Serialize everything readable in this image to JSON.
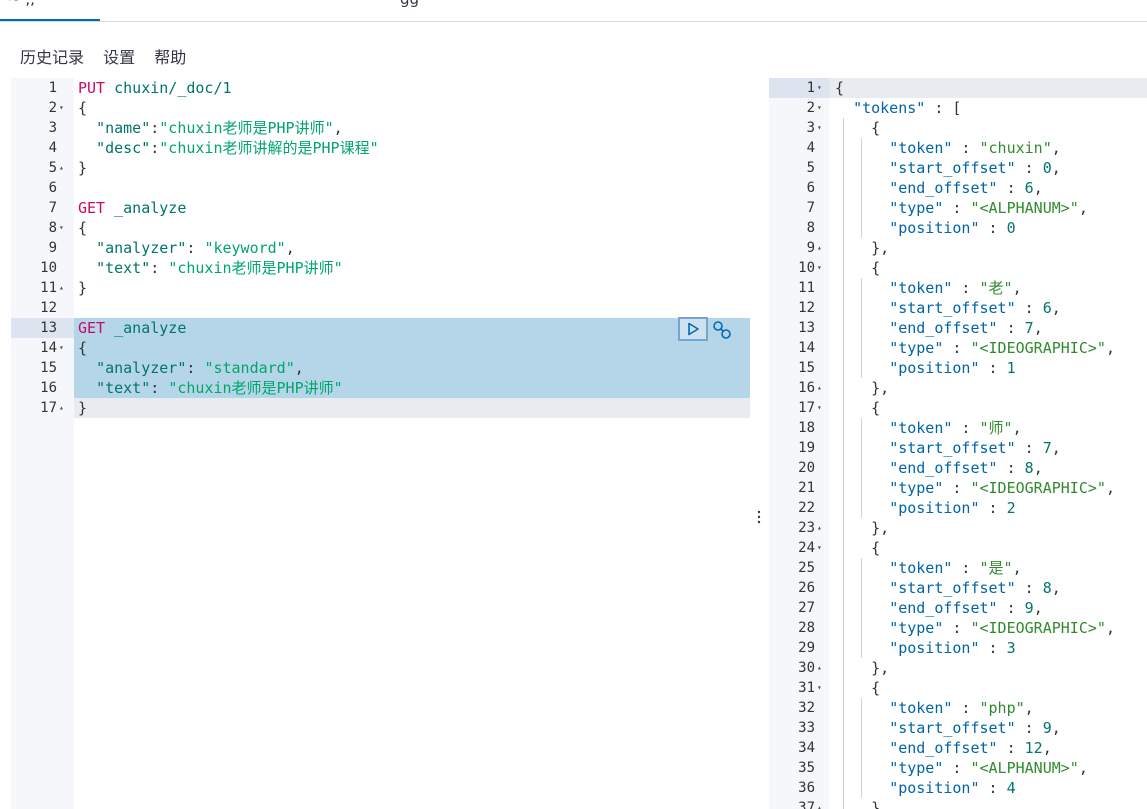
{
  "tabs": {
    "fragment_left": "~ ,,",
    "fragment_right": "gg"
  },
  "menu": {
    "history": "历史记录",
    "settings": "设置",
    "help": "帮助"
  },
  "request_lines": [
    {
      "n": "1",
      "fold": "",
      "parts": [
        [
          "kw",
          "PUT"
        ],
        [
          "pl",
          " "
        ],
        [
          "url",
          "chuxin/_doc/1"
        ]
      ]
    },
    {
      "n": "2",
      "fold": "▾",
      "parts": [
        [
          "pl",
          "{"
        ]
      ]
    },
    {
      "n": "3",
      "fold": "",
      "parts": [
        [
          "pl",
          "  "
        ],
        [
          "key",
          "\"name\""
        ],
        [
          "pl",
          ":"
        ],
        [
          "str",
          "\"chuxin老师是PHP讲师\""
        ],
        [
          "pl",
          ","
        ]
      ]
    },
    {
      "n": "4",
      "fold": "",
      "parts": [
        [
          "pl",
          "  "
        ],
        [
          "key",
          "\"desc\""
        ],
        [
          "pl",
          ":"
        ],
        [
          "str",
          "\"chuxin老师讲解的是PHP课程\""
        ]
      ]
    },
    {
      "n": "5",
      "fold": "▴",
      "parts": [
        [
          "pl",
          "}"
        ]
      ]
    },
    {
      "n": "6",
      "fold": "",
      "parts": []
    },
    {
      "n": "7",
      "fold": "",
      "parts": [
        [
          "kw",
          "GET"
        ],
        [
          "pl",
          " "
        ],
        [
          "url",
          "_analyze"
        ]
      ]
    },
    {
      "n": "8",
      "fold": "▾",
      "parts": [
        [
          "pl",
          "{"
        ]
      ]
    },
    {
      "n": "9",
      "fold": "",
      "parts": [
        [
          "pl",
          "  "
        ],
        [
          "key",
          "\"analyzer\""
        ],
        [
          "pl",
          ": "
        ],
        [
          "str",
          "\"keyword\""
        ],
        [
          "pl",
          ","
        ]
      ]
    },
    {
      "n": "10",
      "fold": "",
      "parts": [
        [
          "pl",
          "  "
        ],
        [
          "key",
          "\"text\""
        ],
        [
          "pl",
          ": "
        ],
        [
          "str",
          "\"chuxin老师是PHP讲师\""
        ]
      ]
    },
    {
      "n": "11",
      "fold": "▴",
      "parts": [
        [
          "pl",
          "}"
        ]
      ]
    },
    {
      "n": "12",
      "fold": "",
      "parts": []
    },
    {
      "n": "13",
      "fold": "",
      "sel": true,
      "parts": [
        [
          "kw",
          "GET"
        ],
        [
          "pl",
          " "
        ],
        [
          "url",
          "_analyze"
        ]
      ]
    },
    {
      "n": "14",
      "fold": "▾",
      "sel": true,
      "parts": [
        [
          "pl",
          "{"
        ]
      ]
    },
    {
      "n": "15",
      "fold": "",
      "sel": true,
      "parts": [
        [
          "pl",
          "  "
        ],
        [
          "key",
          "\"analyzer\""
        ],
        [
          "pl",
          ": "
        ],
        [
          "str",
          "\"standard\""
        ],
        [
          "pl",
          ","
        ]
      ]
    },
    {
      "n": "16",
      "fold": "",
      "sel": true,
      "parts": [
        [
          "pl",
          "  "
        ],
        [
          "key",
          "\"text\""
        ],
        [
          "pl",
          ": "
        ],
        [
          "str",
          "\"chuxin老师是PHP讲师\""
        ]
      ]
    },
    {
      "n": "17",
      "fold": "▴",
      "cur": true,
      "parts": [
        [
          "pl",
          "}"
        ]
      ]
    }
  ],
  "response_lines": [
    {
      "n": "1",
      "fold": "▾",
      "first": true,
      "parts": [
        [
          "pl",
          "{"
        ]
      ]
    },
    {
      "n": "2",
      "fold": "▾",
      "parts": [
        [
          "pl",
          "  "
        ],
        [
          "key2",
          "\"tokens\""
        ],
        [
          "pl",
          " : ["
        ]
      ]
    },
    {
      "n": "3",
      "fold": "▾",
      "parts": [
        [
          "pl",
          "    {"
        ]
      ]
    },
    {
      "n": "4",
      "fold": "",
      "parts": [
        [
          "pl",
          "      "
        ],
        [
          "key2",
          "\"token\""
        ],
        [
          "pl",
          " : "
        ],
        [
          "str2",
          "\"chuxin\""
        ],
        [
          "pl",
          ","
        ]
      ]
    },
    {
      "n": "5",
      "fold": "",
      "parts": [
        [
          "pl",
          "      "
        ],
        [
          "key2",
          "\"start_offset\""
        ],
        [
          "pl",
          " : "
        ],
        [
          "num",
          "0"
        ],
        [
          "pl",
          ","
        ]
      ]
    },
    {
      "n": "6",
      "fold": "",
      "parts": [
        [
          "pl",
          "      "
        ],
        [
          "key2",
          "\"end_offset\""
        ],
        [
          "pl",
          " : "
        ],
        [
          "num",
          "6"
        ],
        [
          "pl",
          ","
        ]
      ]
    },
    {
      "n": "7",
      "fold": "",
      "parts": [
        [
          "pl",
          "      "
        ],
        [
          "key2",
          "\"type\""
        ],
        [
          "pl",
          " : "
        ],
        [
          "str2",
          "\"<ALPHANUM>\""
        ],
        [
          "pl",
          ","
        ]
      ]
    },
    {
      "n": "8",
      "fold": "",
      "parts": [
        [
          "pl",
          "      "
        ],
        [
          "key2",
          "\"position\""
        ],
        [
          "pl",
          " : "
        ],
        [
          "num",
          "0"
        ]
      ]
    },
    {
      "n": "9",
      "fold": "▴",
      "parts": [
        [
          "pl",
          "    },"
        ]
      ]
    },
    {
      "n": "10",
      "fold": "▾",
      "parts": [
        [
          "pl",
          "    {"
        ]
      ]
    },
    {
      "n": "11",
      "fold": "",
      "parts": [
        [
          "pl",
          "      "
        ],
        [
          "key2",
          "\"token\""
        ],
        [
          "pl",
          " : "
        ],
        [
          "str2",
          "\"老\""
        ],
        [
          "pl",
          ","
        ]
      ]
    },
    {
      "n": "12",
      "fold": "",
      "parts": [
        [
          "pl",
          "      "
        ],
        [
          "key2",
          "\"start_offset\""
        ],
        [
          "pl",
          " : "
        ],
        [
          "num",
          "6"
        ],
        [
          "pl",
          ","
        ]
      ]
    },
    {
      "n": "13",
      "fold": "",
      "parts": [
        [
          "pl",
          "      "
        ],
        [
          "key2",
          "\"end_offset\""
        ],
        [
          "pl",
          " : "
        ],
        [
          "num",
          "7"
        ],
        [
          "pl",
          ","
        ]
      ]
    },
    {
      "n": "14",
      "fold": "",
      "parts": [
        [
          "pl",
          "      "
        ],
        [
          "key2",
          "\"type\""
        ],
        [
          "pl",
          " : "
        ],
        [
          "str2",
          "\"<IDEOGRAPHIC>\""
        ],
        [
          "pl",
          ","
        ]
      ]
    },
    {
      "n": "15",
      "fold": "",
      "parts": [
        [
          "pl",
          "      "
        ],
        [
          "key2",
          "\"position\""
        ],
        [
          "pl",
          " : "
        ],
        [
          "num",
          "1"
        ]
      ]
    },
    {
      "n": "16",
      "fold": "▴",
      "parts": [
        [
          "pl",
          "    },"
        ]
      ]
    },
    {
      "n": "17",
      "fold": "▾",
      "parts": [
        [
          "pl",
          "    {"
        ]
      ]
    },
    {
      "n": "18",
      "fold": "",
      "parts": [
        [
          "pl",
          "      "
        ],
        [
          "key2",
          "\"token\""
        ],
        [
          "pl",
          " : "
        ],
        [
          "str2",
          "\"师\""
        ],
        [
          "pl",
          ","
        ]
      ]
    },
    {
      "n": "19",
      "fold": "",
      "parts": [
        [
          "pl",
          "      "
        ],
        [
          "key2",
          "\"start_offset\""
        ],
        [
          "pl",
          " : "
        ],
        [
          "num",
          "7"
        ],
        [
          "pl",
          ","
        ]
      ]
    },
    {
      "n": "20",
      "fold": "",
      "parts": [
        [
          "pl",
          "      "
        ],
        [
          "key2",
          "\"end_offset\""
        ],
        [
          "pl",
          " : "
        ],
        [
          "num",
          "8"
        ],
        [
          "pl",
          ","
        ]
      ]
    },
    {
      "n": "21",
      "fold": "",
      "parts": [
        [
          "pl",
          "      "
        ],
        [
          "key2",
          "\"type\""
        ],
        [
          "pl",
          " : "
        ],
        [
          "str2",
          "\"<IDEOGRAPHIC>\""
        ],
        [
          "pl",
          ","
        ]
      ]
    },
    {
      "n": "22",
      "fold": "",
      "parts": [
        [
          "pl",
          "      "
        ],
        [
          "key2",
          "\"position\""
        ],
        [
          "pl",
          " : "
        ],
        [
          "num",
          "2"
        ]
      ]
    },
    {
      "n": "23",
      "fold": "▴",
      "parts": [
        [
          "pl",
          "    },"
        ]
      ]
    },
    {
      "n": "24",
      "fold": "▾",
      "parts": [
        [
          "pl",
          "    {"
        ]
      ]
    },
    {
      "n": "25",
      "fold": "",
      "parts": [
        [
          "pl",
          "      "
        ],
        [
          "key2",
          "\"token\""
        ],
        [
          "pl",
          " : "
        ],
        [
          "str2",
          "\"是\""
        ],
        [
          "pl",
          ","
        ]
      ]
    },
    {
      "n": "26",
      "fold": "",
      "parts": [
        [
          "pl",
          "      "
        ],
        [
          "key2",
          "\"start_offset\""
        ],
        [
          "pl",
          " : "
        ],
        [
          "num",
          "8"
        ],
        [
          "pl",
          ","
        ]
      ]
    },
    {
      "n": "27",
      "fold": "",
      "parts": [
        [
          "pl",
          "      "
        ],
        [
          "key2",
          "\"end_offset\""
        ],
        [
          "pl",
          " : "
        ],
        [
          "num",
          "9"
        ],
        [
          "pl",
          ","
        ]
      ]
    },
    {
      "n": "28",
      "fold": "",
      "parts": [
        [
          "pl",
          "      "
        ],
        [
          "key2",
          "\"type\""
        ],
        [
          "pl",
          " : "
        ],
        [
          "str2",
          "\"<IDEOGRAPHIC>\""
        ],
        [
          "pl",
          ","
        ]
      ]
    },
    {
      "n": "29",
      "fold": "",
      "parts": [
        [
          "pl",
          "      "
        ],
        [
          "key2",
          "\"position\""
        ],
        [
          "pl",
          " : "
        ],
        [
          "num",
          "3"
        ]
      ]
    },
    {
      "n": "30",
      "fold": "▴",
      "parts": [
        [
          "pl",
          "    },"
        ]
      ]
    },
    {
      "n": "31",
      "fold": "▾",
      "parts": [
        [
          "pl",
          "    {"
        ]
      ]
    },
    {
      "n": "32",
      "fold": "",
      "parts": [
        [
          "pl",
          "      "
        ],
        [
          "key2",
          "\"token\""
        ],
        [
          "pl",
          " : "
        ],
        [
          "str2",
          "\"php\""
        ],
        [
          "pl",
          ","
        ]
      ]
    },
    {
      "n": "33",
      "fold": "",
      "parts": [
        [
          "pl",
          "      "
        ],
        [
          "key2",
          "\"start_offset\""
        ],
        [
          "pl",
          " : "
        ],
        [
          "num",
          "9"
        ],
        [
          "pl",
          ","
        ]
      ]
    },
    {
      "n": "34",
      "fold": "",
      "parts": [
        [
          "pl",
          "      "
        ],
        [
          "key2",
          "\"end_offset\""
        ],
        [
          "pl",
          " : "
        ],
        [
          "num",
          "12"
        ],
        [
          "pl",
          ","
        ]
      ]
    },
    {
      "n": "35",
      "fold": "",
      "parts": [
        [
          "pl",
          "      "
        ],
        [
          "key2",
          "\"type\""
        ],
        [
          "pl",
          " : "
        ],
        [
          "str2",
          "\"<ALPHANUM>\""
        ],
        [
          "pl",
          ","
        ]
      ]
    },
    {
      "n": "36",
      "fold": "",
      "parts": [
        [
          "pl",
          "      "
        ],
        [
          "key2",
          "\"position\""
        ],
        [
          "pl",
          " : "
        ],
        [
          "num",
          "4"
        ]
      ]
    },
    {
      "n": "37",
      "fold": "▴",
      "parts": [
        [
          "pl",
          "    },"
        ]
      ]
    }
  ],
  "icons": {
    "play": "play-icon",
    "wrench": "wrench-icon",
    "divider": "vertical-dots-icon"
  }
}
